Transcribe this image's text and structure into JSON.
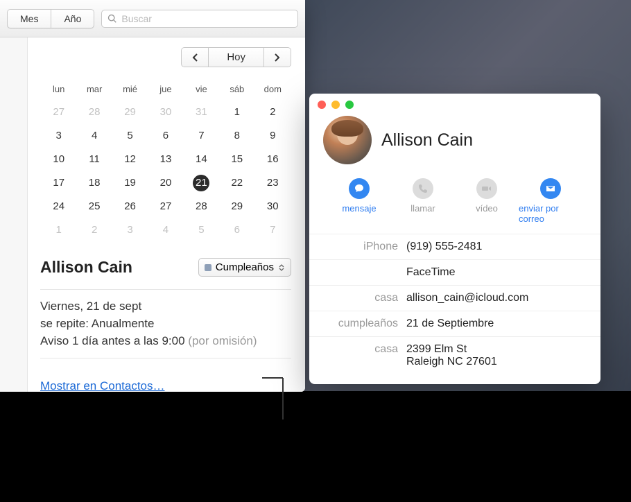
{
  "toolbar": {
    "seg_month": "Mes",
    "seg_year": "Año",
    "search_placeholder": "Buscar"
  },
  "nav": {
    "today": "Hoy"
  },
  "weekdays": [
    "lun",
    "mar",
    "mié",
    "jue",
    "vie",
    "sáb",
    "dom"
  ],
  "cells": [
    {
      "d": "27",
      "dim": true
    },
    {
      "d": "28",
      "dim": true
    },
    {
      "d": "29",
      "dim": true
    },
    {
      "d": "30",
      "dim": true
    },
    {
      "d": "31",
      "dim": true
    },
    {
      "d": "1"
    },
    {
      "d": "2"
    },
    {
      "d": "3"
    },
    {
      "d": "4"
    },
    {
      "d": "5"
    },
    {
      "d": "6"
    },
    {
      "d": "7"
    },
    {
      "d": "8"
    },
    {
      "d": "9"
    },
    {
      "d": "10"
    },
    {
      "d": "11"
    },
    {
      "d": "12"
    },
    {
      "d": "13"
    },
    {
      "d": "14"
    },
    {
      "d": "15"
    },
    {
      "d": "16"
    },
    {
      "d": "17"
    },
    {
      "d": "18"
    },
    {
      "d": "19"
    },
    {
      "d": "20"
    },
    {
      "d": "21",
      "sel": true
    },
    {
      "d": "22"
    },
    {
      "d": "23"
    },
    {
      "d": "24"
    },
    {
      "d": "25"
    },
    {
      "d": "26"
    },
    {
      "d": "27"
    },
    {
      "d": "28"
    },
    {
      "d": "29"
    },
    {
      "d": "30"
    },
    {
      "d": "1",
      "dim": true
    },
    {
      "d": "2",
      "dim": true
    },
    {
      "d": "3",
      "dim": true
    },
    {
      "d": "4",
      "dim": true
    },
    {
      "d": "5",
      "dim": true
    },
    {
      "d": "6",
      "dim": true
    },
    {
      "d": "7",
      "dim": true
    }
  ],
  "event": {
    "title": "Allison Cain",
    "calendar_label": "Cumpleaños",
    "date": "Viernes, 21 de sept",
    "repeat": "se repite: Anualmente",
    "alert_prefix": "Aviso 1 día antes a las 9:00",
    "alert_suffix": "(por omisión)",
    "contacts_link": "Mostrar en Contactos…"
  },
  "contact": {
    "name": "Allison Cain",
    "actions": {
      "message": "mensaje",
      "call": "llamar",
      "video": "vídeo",
      "email": "enviar por correo"
    },
    "rows": {
      "iphone_k": "iPhone",
      "iphone_v": "(919) 555-2481",
      "facetime_k": "",
      "facetime_v": "FaceTime",
      "home_email_k": "casa",
      "home_email_v": "allison_cain@icloud.com",
      "birthday_k": "cumpleaños",
      "birthday_v": "21 de Septiembre",
      "home_addr_k": "casa",
      "home_addr_v1": "2399 Elm St",
      "home_addr_v2": "Raleigh NC 27601"
    }
  }
}
